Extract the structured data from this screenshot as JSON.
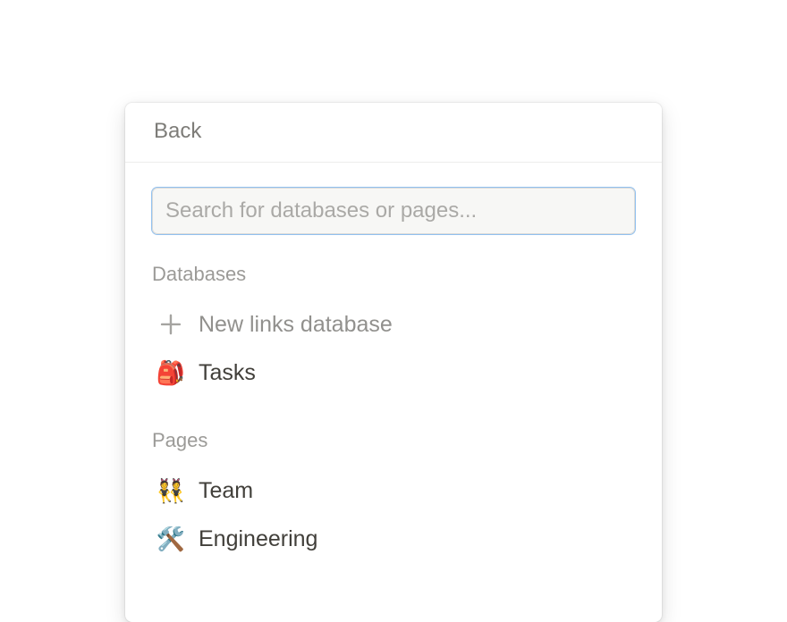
{
  "header": {
    "back_label": "Back"
  },
  "search": {
    "placeholder": "Search for databases or pages..."
  },
  "sections": {
    "databases": {
      "label": "Databases",
      "items": [
        {
          "icon": "plus",
          "label": "New links database",
          "is_new": true
        },
        {
          "icon": "🎒",
          "label": "Tasks",
          "is_new": false
        }
      ]
    },
    "pages": {
      "label": "Pages",
      "items": [
        {
          "icon": "👯",
          "label": "Team"
        },
        {
          "icon": "🛠️",
          "label": "Engineering"
        }
      ]
    }
  }
}
